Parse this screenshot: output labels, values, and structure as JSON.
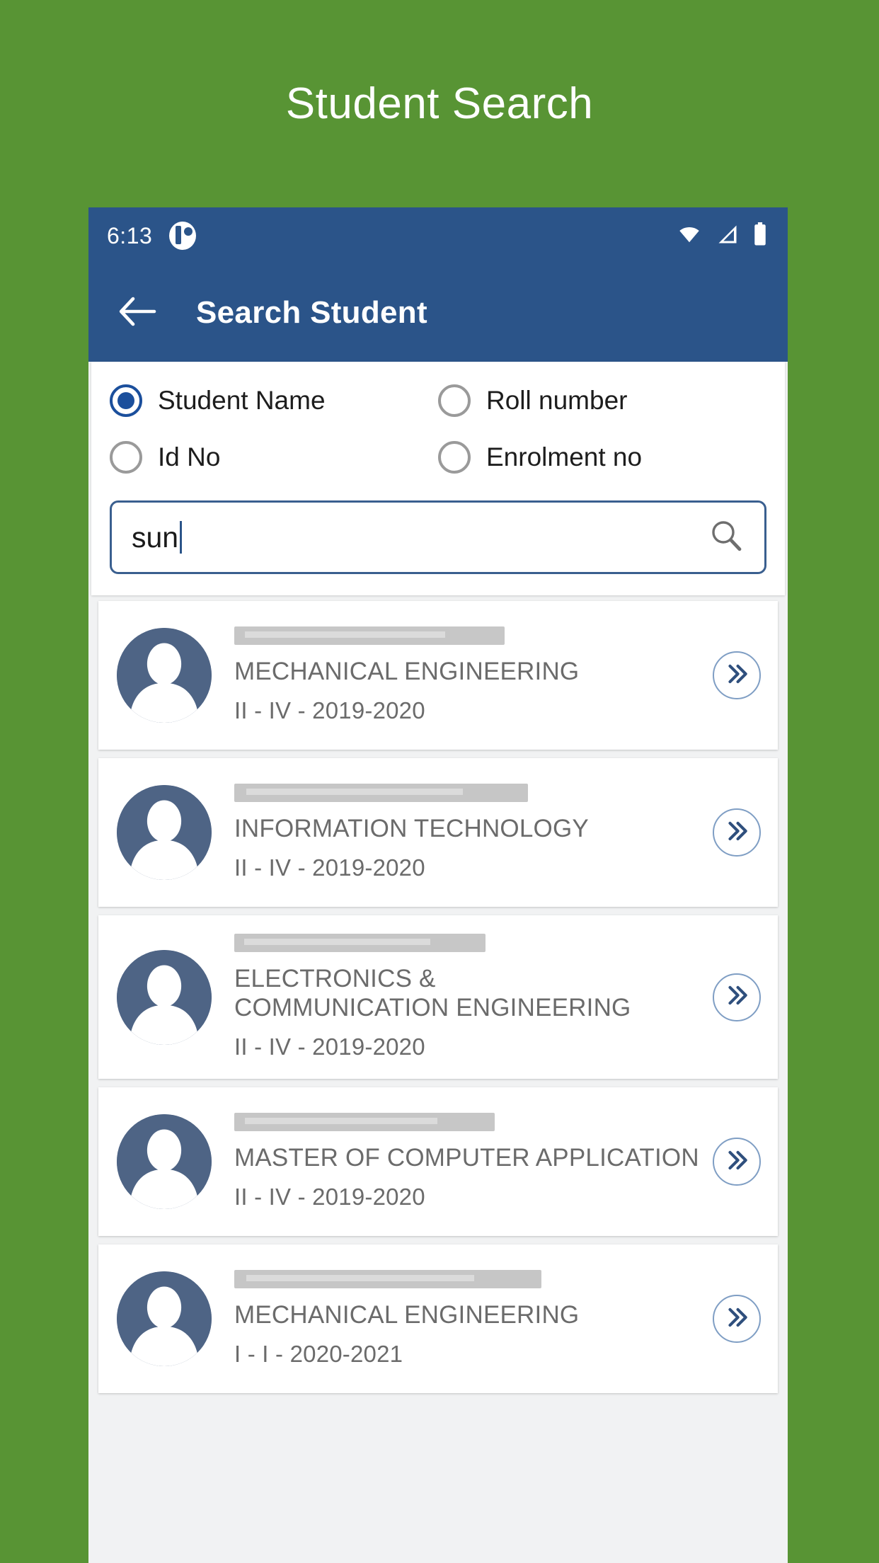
{
  "page": {
    "title": "Student Search",
    "background_color": "#589434",
    "accent_color": "#2b5489"
  },
  "statusbar": {
    "time": "6:13",
    "app_icon": "app-notification-icon",
    "wifi_icon": "wifi-icon",
    "signal_icon": "cellular-signal-icon",
    "battery_icon": "battery-icon"
  },
  "appbar": {
    "back_icon": "back-arrow-icon",
    "title": "Search Student"
  },
  "search": {
    "options": [
      {
        "label": "Student Name",
        "selected": true
      },
      {
        "label": "Roll number",
        "selected": false
      },
      {
        "label": "Id No",
        "selected": false
      },
      {
        "label": "Enrolment no",
        "selected": false
      }
    ],
    "input_value": "sun",
    "input_placeholder": "",
    "search_icon": "magnifier-icon"
  },
  "results": [
    {
      "name": "",
      "name_redacted": true,
      "department": "MECHANICAL ENGINEERING",
      "meta": "II - IV - 2019-2020",
      "avatar_icon": "person-avatar-icon",
      "action_icon": "double-chevron-right-icon"
    },
    {
      "name": "",
      "name_redacted": true,
      "department": "INFORMATION TECHNOLOGY",
      "meta": "II - IV - 2019-2020",
      "avatar_icon": "person-avatar-icon",
      "action_icon": "double-chevron-right-icon"
    },
    {
      "name": "",
      "name_redacted": true,
      "department": "ELECTRONICS & COMMUNICATION ENGINEERING",
      "meta": "II - IV - 2019-2020",
      "avatar_icon": "person-avatar-icon",
      "action_icon": "double-chevron-right-icon"
    },
    {
      "name": "",
      "name_redacted": true,
      "department": "MASTER OF COMPUTER APPLICATION",
      "meta": "II - IV - 2019-2020",
      "avatar_icon": "person-avatar-icon",
      "action_icon": "double-chevron-right-icon"
    },
    {
      "name": "",
      "name_redacted": true,
      "department": "MECHANICAL ENGINEERING",
      "meta": "I - I - 2020-2021",
      "avatar_icon": "person-avatar-icon",
      "action_icon": "double-chevron-right-icon"
    }
  ]
}
